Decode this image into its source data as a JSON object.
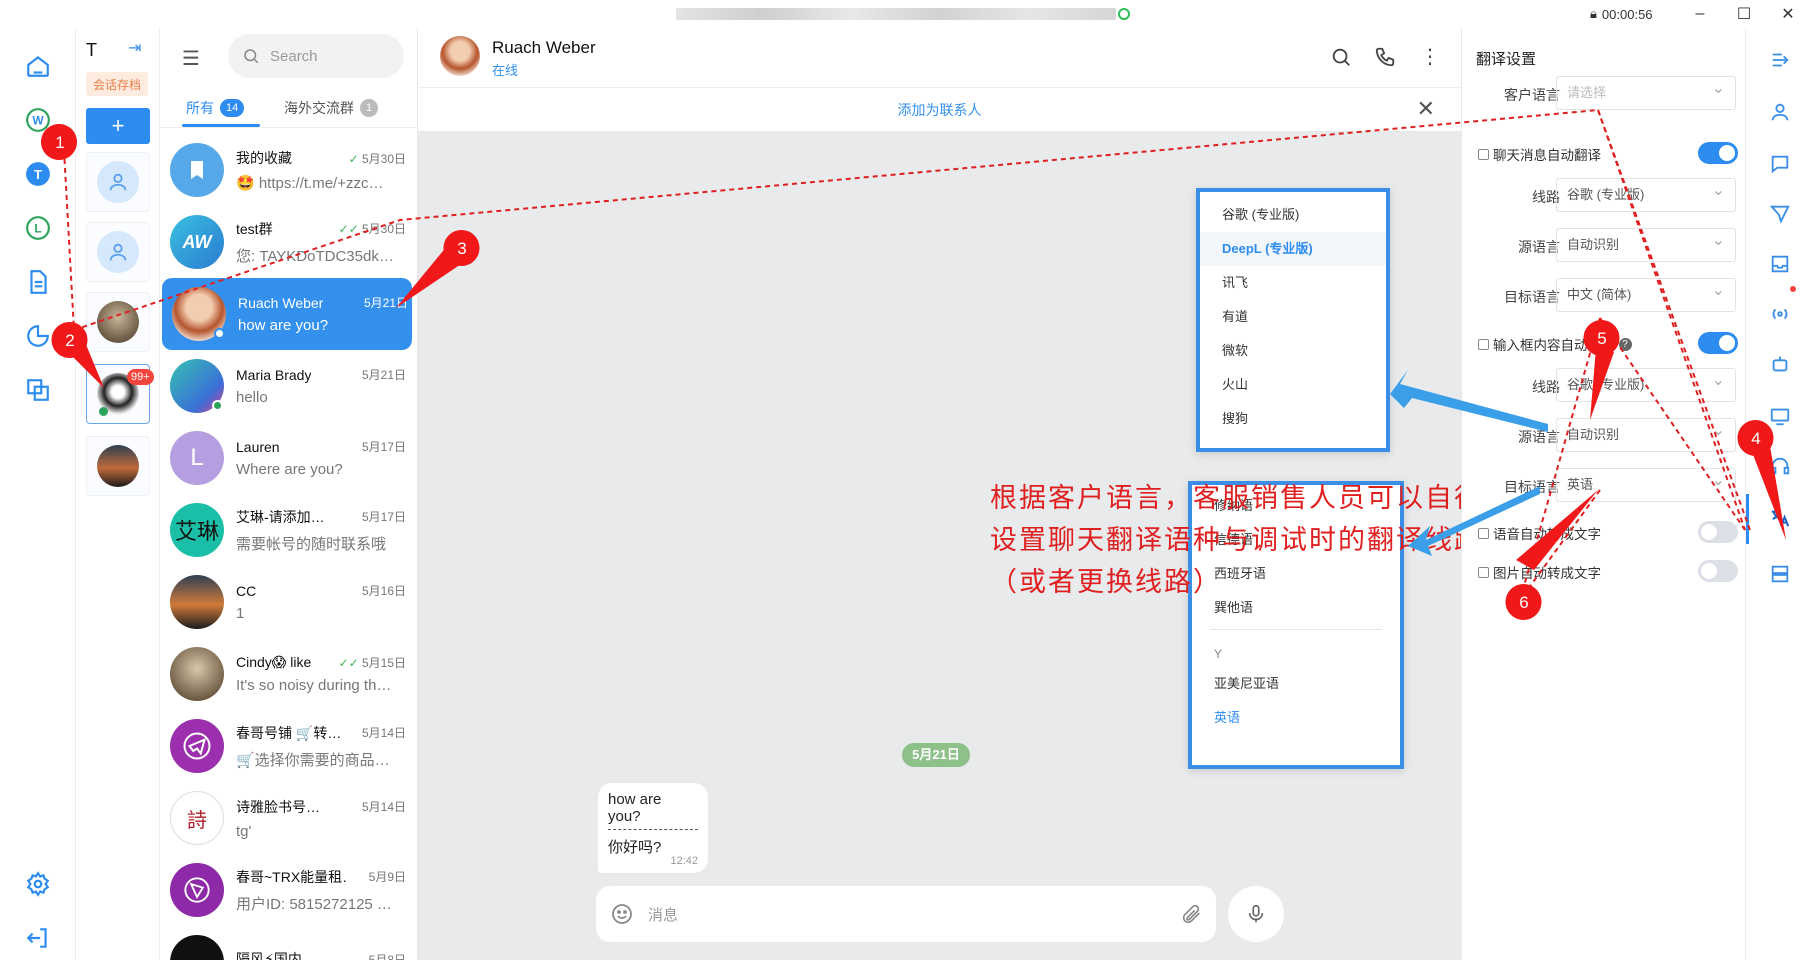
{
  "titlebar": {
    "timer": "00:00:56",
    "minimize": "–",
    "maximize": "☐",
    "close": "✕"
  },
  "accounts": {
    "letter": "T",
    "archive_tag": "会话存档",
    "add": "+",
    "badge": "99+"
  },
  "chatlist": {
    "search_placeholder": "Search",
    "tabs": [
      {
        "label": "所有",
        "count": "14"
      },
      {
        "label": "海外交流群",
        "count": "1"
      }
    ],
    "items": [
      {
        "name": "我的收藏",
        "date": "5月30日",
        "msg": "🤩 https://t.me/+zzc…",
        "check": "✓"
      },
      {
        "name": "test群",
        "date": "5月30日",
        "msg": "您: TAYKDoTDC35dk…",
        "check": "✓✓"
      },
      {
        "name": "Ruach Weber",
        "date": "5月21日",
        "msg": "how are you?",
        "check": ""
      },
      {
        "name": "Maria Brady",
        "date": "5月21日",
        "msg": "hello",
        "check": ""
      },
      {
        "name": "Lauren",
        "date": "5月17日",
        "msg": "Where are you?",
        "check": ""
      },
      {
        "name": "艾琳-请添加…",
        "date": "5月17日",
        "msg": "需要帐号的随时联系哦",
        "check": ""
      },
      {
        "name": "CC",
        "date": "5月16日",
        "msg": "1",
        "check": ""
      },
      {
        "name": "Cindy😱 like",
        "date": "5月15日",
        "msg": "It's so noisy during th…",
        "check": "✓✓"
      },
      {
        "name": "春哥号铺 🛒转…",
        "date": "5月14日",
        "msg": "🛒选择你需要的商品…",
        "check": ""
      },
      {
        "name": "诗雅脸书号…",
        "date": "5月14日",
        "msg": "tg'",
        "check": ""
      },
      {
        "name": "春哥~TRX能量租…",
        "date": "5月9日",
        "msg": "用户ID: 5815272125 …",
        "check": ""
      },
      {
        "name": "隔风⚡国内…",
        "date": "5月8日",
        "msg": "",
        "check": ""
      }
    ],
    "avatar_letters": {
      "lauren": "L",
      "ailin": "艾琳"
    }
  },
  "chat": {
    "name": "Ruach Weber",
    "status": "在线",
    "banner": "添加为联系人",
    "date_chip": "5月21日",
    "message_original": "how are you?",
    "message_translated": "你好吗?",
    "message_time": "12:42",
    "composer_placeholder": "消息",
    "annotation": "根据客户语言，客服销售人员可以自行设置聊天翻译语种与调试时的翻译线路（或者更换线路）",
    "route_options": [
      "谷歌 (专业版)",
      "DeepL (专业版)",
      "讯飞",
      "有道",
      "微软",
      "火山",
      "搜狗"
    ],
    "language_options": [
      "修纳语",
      "信德语",
      "西班牙语",
      "巽他语"
    ],
    "language_group": "Y",
    "language_options_2": [
      "亚美尼亚语",
      "英语"
    ]
  },
  "settings": {
    "title": "翻译设置",
    "customer_lang_label": "客户语言",
    "customer_lang_placeholder": "请选择",
    "auto_translate_label": "聊天消息自动翻译",
    "route_label": "线路",
    "route_value": "谷歌 (专业版)",
    "source_label": "源语言",
    "source_value": "自动识别",
    "target_label": "目标语言",
    "target_value": "中文 (简体)",
    "input_auto_label": "输入框内容自动翻译",
    "route2_value": "谷歌 (专业版)",
    "source2_value": "自动识别",
    "target2_value": "英语",
    "voice_label": "语音自动转成文字",
    "image_label": "图片自动转成文字"
  },
  "markers": [
    "1",
    "2",
    "3",
    "4",
    "5",
    "6"
  ],
  "colors": {
    "accent": "#2d8cf0",
    "annotation": "#e02020",
    "active_chat": "#3390ec"
  }
}
